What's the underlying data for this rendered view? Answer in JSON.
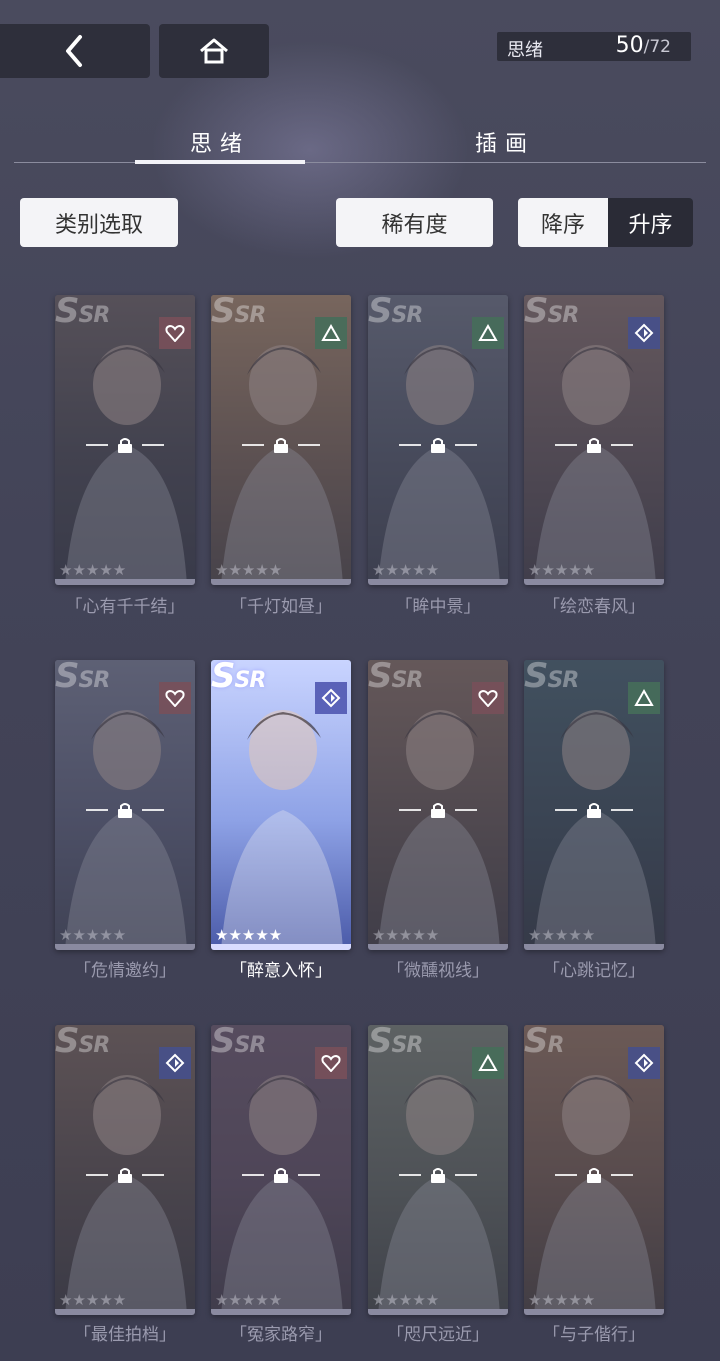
{
  "header": {
    "back_label": "back",
    "home_label": "home",
    "counter_label": "思绪",
    "counter_value": "50",
    "counter_total": "/72"
  },
  "tabs": [
    {
      "label": "思绪",
      "active": true
    },
    {
      "label": "插画",
      "active": false
    }
  ],
  "filters": {
    "category_label": "类别选取",
    "rarity_label": "稀有度",
    "desc_label": "降序",
    "asc_label": "升序"
  },
  "cards": [
    {
      "title": "「心有千千结」",
      "rarity": "SSR",
      "badge": "heart-icon",
      "stars": "★★★★★",
      "locked": true
    },
    {
      "title": "「千灯如昼」",
      "rarity": "SSR",
      "badge": "triangle-icon",
      "stars": "★★★★★",
      "locked": true
    },
    {
      "title": "「眸中景」",
      "rarity": "SSR",
      "badge": "triangle-icon",
      "stars": "★★★★★",
      "locked": true
    },
    {
      "title": "「绘恋春风」",
      "rarity": "SSR",
      "badge": "diamond-icon",
      "stars": "★★★★★",
      "locked": true
    },
    {
      "title": "「危情邀约」",
      "rarity": "SSR",
      "badge": "heart-icon",
      "stars": "★★★★★",
      "locked": true
    },
    {
      "title": "「醉意入怀」",
      "rarity": "SSR",
      "badge": "diamond-icon",
      "stars": "★★★★★",
      "locked": false
    },
    {
      "title": "「微醺视线」",
      "rarity": "SSR",
      "badge": "heart-icon",
      "stars": "★★★★★",
      "locked": true
    },
    {
      "title": "「心跳记忆」",
      "rarity": "SSR",
      "badge": "triangle-icon",
      "stars": "★★★★★",
      "locked": true
    },
    {
      "title": "「最佳拍档」",
      "rarity": "SSR",
      "badge": "diamond-icon",
      "stars": "★★★★★",
      "locked": true
    },
    {
      "title": "「冤家路窄」",
      "rarity": "SSR",
      "badge": "heart-icon",
      "stars": "★★★★★",
      "locked": true
    },
    {
      "title": "「咫尺远近」",
      "rarity": "SSR",
      "badge": "triangle-icon",
      "stars": "★★★★★",
      "locked": true
    },
    {
      "title": "「与子偕行」",
      "rarity": "SR",
      "badge": "diamond-icon",
      "stars": "★★★★★",
      "locked": true
    }
  ],
  "colors": {
    "background": "#45465a",
    "active_card_glow": "#9fa4ff"
  }
}
